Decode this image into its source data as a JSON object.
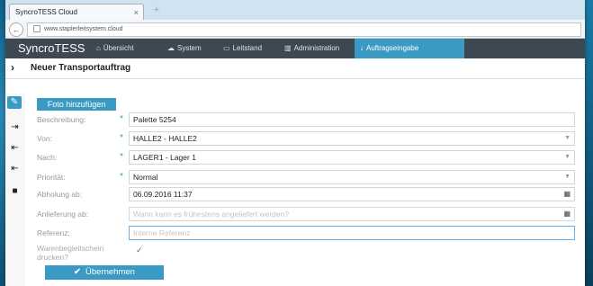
{
  "browser": {
    "tab_title": "SyncroTESS Cloud",
    "tab_close": "×",
    "new_tab": "+",
    "url": "www.staplerleitsystem.cloud"
  },
  "navbar": {
    "brand": "SyncroTESS",
    "items": [
      {
        "label": "Übersicht",
        "icon": "home-icon",
        "glyph": "⌂"
      },
      {
        "label": "System",
        "icon": "cloud-icon",
        "glyph": "☁"
      },
      {
        "label": "Leitstand",
        "icon": "monitor-icon",
        "glyph": "▭"
      },
      {
        "label": "Administration",
        "icon": "building-icon",
        "glyph": "▥"
      },
      {
        "label": "Auftragseingabe",
        "icon": "pin-icon",
        "glyph": "↓"
      }
    ]
  },
  "page": {
    "title": "Neuer Transportauftrag"
  },
  "form": {
    "photo_button": "Foto hinzufügen",
    "fields": [
      {
        "label": "Beschreibung:",
        "value": "Palette 5254",
        "required": true
      },
      {
        "label": "Von:",
        "value": "HALLE2 - HALLE2",
        "required": true
      },
      {
        "label": "Nach:",
        "value": "LAGER1 - Lager 1",
        "required": true
      },
      {
        "label": "Priorität:",
        "value": "Normal",
        "required": true
      },
      {
        "label": "Abholung ab:",
        "value": "06.09.2016 11:37",
        "required": false
      },
      {
        "label": "Anlieferung ab:",
        "placeholder": "Wann kann es frühestens angeliefert werden?",
        "required": false
      },
      {
        "label": "Referenz:",
        "placeholder": "Interne Referenz",
        "required": false
      },
      {
        "label": "Warenbegleitschein drucken?",
        "checked": true
      }
    ],
    "required_marker": "*",
    "submit_button": "Übernehmen"
  },
  "colors": {
    "accent": "#3a9ac3",
    "navbar": "#3d4852"
  }
}
